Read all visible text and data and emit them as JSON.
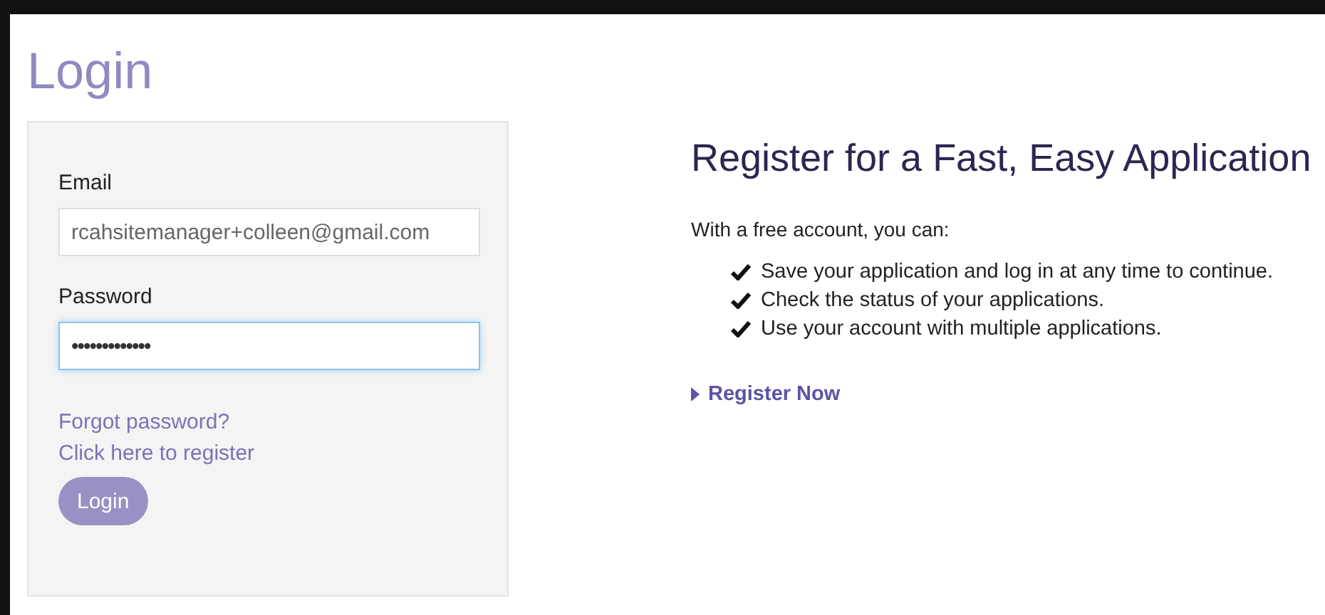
{
  "title": "Login",
  "form": {
    "email": {
      "label": "Email",
      "value": "rcahsitemanager+colleen@gmail.com",
      "focused": false
    },
    "password": {
      "label": "Password",
      "value": "•••••••••••••",
      "focused": true
    },
    "links": [
      "Forgot password?",
      "Click here to register"
    ],
    "button": "Login"
  },
  "register": {
    "heading": "Register for a Fast, Easy Application",
    "intro": "With a free account, you can:",
    "benefits": [
      "Save your application and log in at any time to continue.",
      "Check the status of your applications.",
      "Use your account with multiple applications."
    ],
    "link": "Register Now"
  }
}
